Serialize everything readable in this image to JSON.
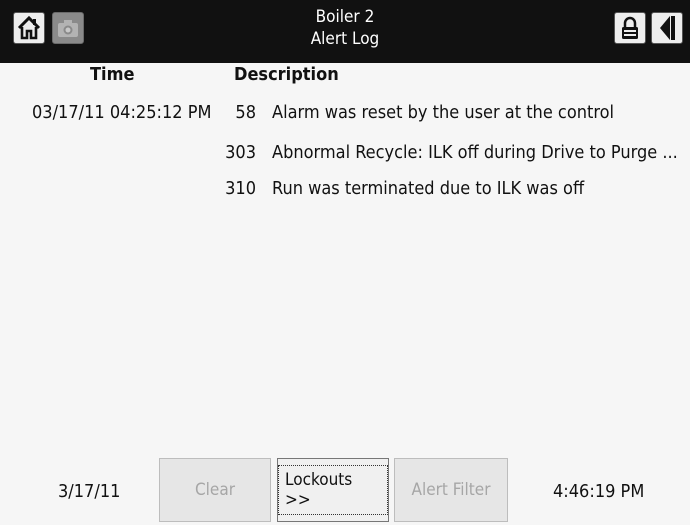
{
  "header": {
    "title_line1": "Boiler 2",
    "title_line2": "Alert Log",
    "icons": [
      "home-icon",
      "camera-icon",
      "lock-icon",
      "back-icon"
    ]
  },
  "columns": {
    "time": "Time",
    "description": "Description"
  },
  "rows": [
    {
      "time": "03/17/11 04:25:12 PM",
      "code": "58",
      "description": "Alarm was reset by the user at the control"
    },
    {
      "time": "",
      "code": "303",
      "description": "Abnormal Recycle: ILK off during Drive to Purge ..."
    },
    {
      "time": "",
      "code": "310",
      "description": "Run was terminated due to ILK was off"
    }
  ],
  "footer": {
    "date": "3/17/11",
    "clear_label": "Clear",
    "lockouts_label": "Lockouts >>",
    "alert_filter_label": "Alert Filter",
    "clock": "4:46:19 PM"
  }
}
